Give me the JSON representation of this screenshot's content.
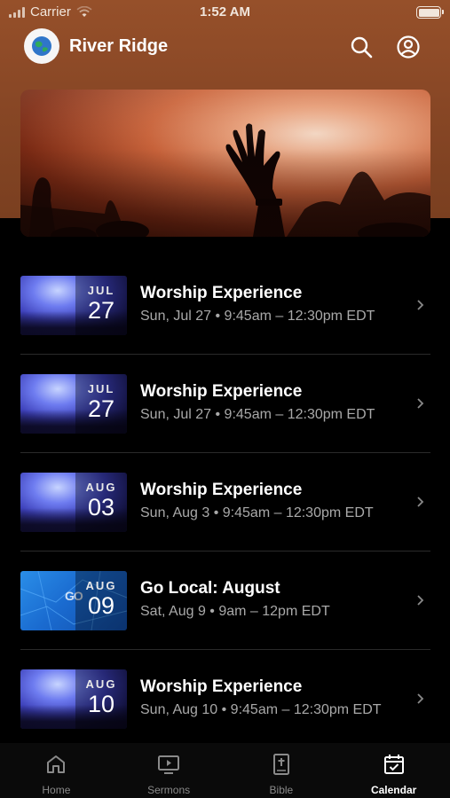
{
  "status_bar": {
    "carrier": "Carrier",
    "time": "1:52 AM"
  },
  "header": {
    "title": "River Ridge"
  },
  "events": [
    {
      "title": "Worship Experience",
      "meta": "Sun, Jul 27 • 9:45am – 12:30pm EDT",
      "month": "JUL",
      "day": "27",
      "thumb": "worship"
    },
    {
      "title": "Worship Experience",
      "meta": "Sun, Jul 27 • 9:45am – 12:30pm EDT",
      "month": "JUL",
      "day": "27",
      "thumb": "worship"
    },
    {
      "title": "Worship Experience",
      "meta": "Sun, Aug 3 • 9:45am – 12:30pm EDT",
      "month": "AUG",
      "day": "03",
      "thumb": "worship"
    },
    {
      "title": "Go Local: August",
      "meta": "Sat, Aug 9 • 9am – 12pm EDT",
      "month": "AUG",
      "day": "09",
      "thumb": "golocal",
      "thumb_text": "GO"
    },
    {
      "title": "Worship Experience",
      "meta": "Sun, Aug 10 • 9:45am – 12:30pm EDT",
      "month": "AUG",
      "day": "10",
      "thumb": "worship"
    }
  ],
  "tabs": [
    {
      "label": "Home",
      "icon": "home-icon"
    },
    {
      "label": "Sermons",
      "icon": "video-icon"
    },
    {
      "label": "Bible",
      "icon": "bible-icon"
    },
    {
      "label": "Calendar",
      "icon": "calendar-icon",
      "active": true
    }
  ],
  "colors": {
    "header_brown": "#8a4826",
    "background": "#000000",
    "muted_text": "#a9a9a9"
  }
}
